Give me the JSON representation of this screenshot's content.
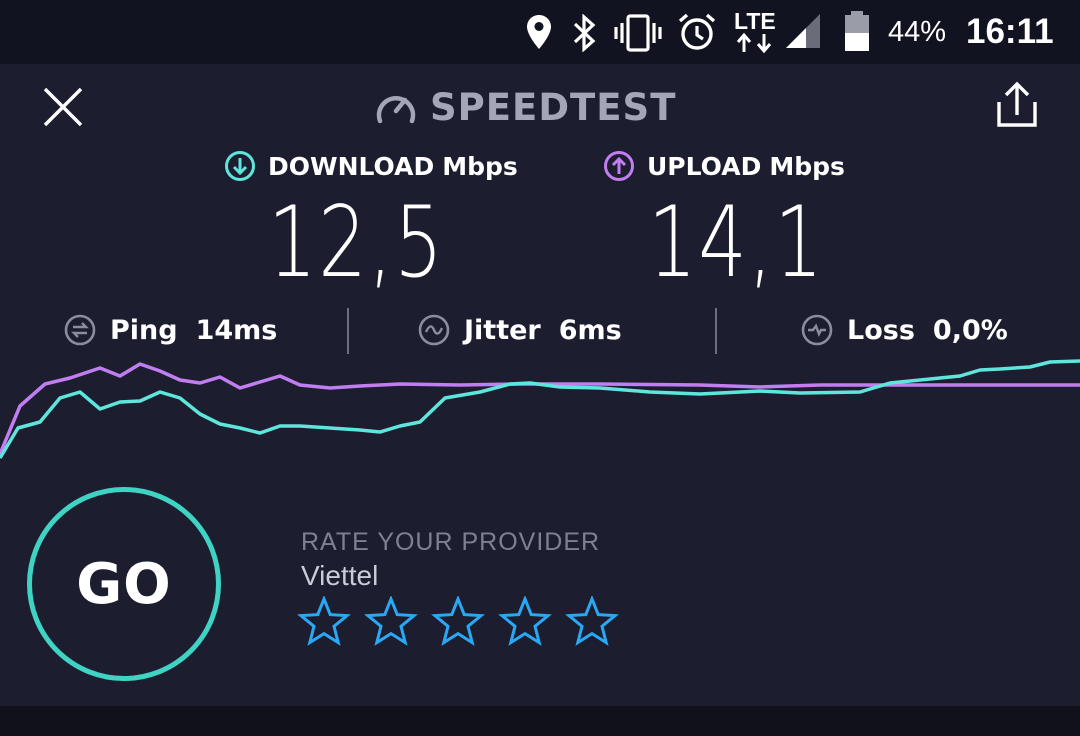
{
  "status_bar": {
    "battery_percent": "44%",
    "time": "16:11",
    "network": "LTE",
    "icons": [
      "location-icon",
      "bluetooth-icon",
      "vibrate-icon",
      "alarm-icon",
      "lte-icon",
      "signal-icon",
      "battery-icon"
    ]
  },
  "header": {
    "brand": "SPEEDTEST",
    "close_icon": "close-icon",
    "share_icon": "share-icon",
    "logo_icon": "speedometer-icon"
  },
  "download": {
    "label": "DOWNLOAD",
    "unit": "Mbps",
    "value": "12,5",
    "color": "#5ee6dc"
  },
  "upload": {
    "label": "UPLOAD",
    "unit": "Mbps",
    "value": "14,1",
    "color": "#c17ef0"
  },
  "stats": {
    "ping": {
      "label": "Ping",
      "value": "14ms"
    },
    "jitter": {
      "label": "Jitter",
      "value": "6ms"
    },
    "loss": {
      "label": "Loss",
      "value": "0,0%"
    }
  },
  "go_button": {
    "label": "GO",
    "color": "#3fd3c4"
  },
  "rating": {
    "label": "RATE YOUR PROVIDER",
    "provider": "Viettel",
    "stars_total": 5,
    "stars_filled": 0,
    "star_color": "#2aa8f5"
  }
}
